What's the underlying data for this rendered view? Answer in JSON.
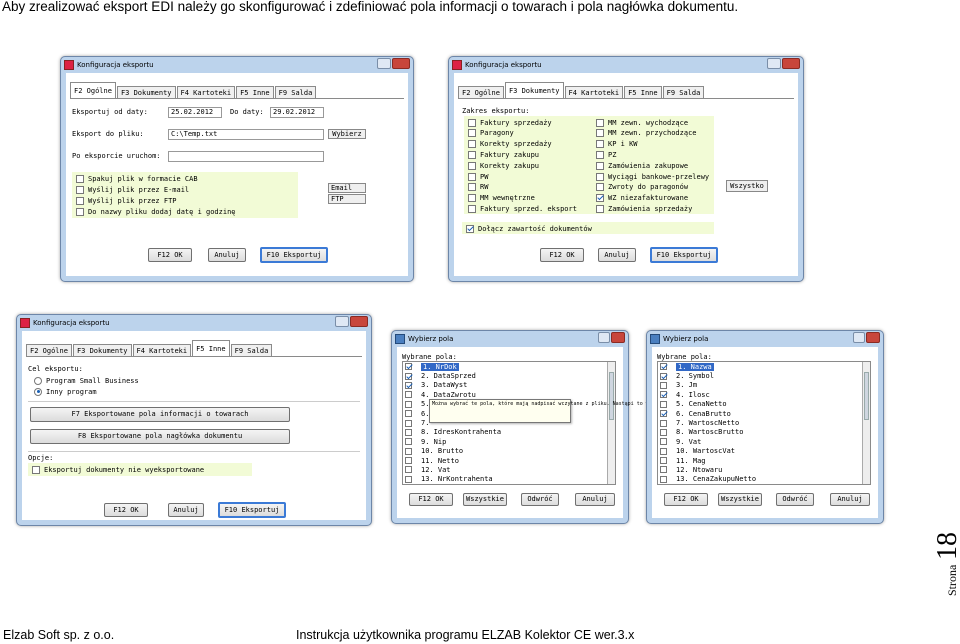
{
  "heading": "Aby zrealizować eksport EDI należy go skonfigurować i zdefiniować pola informacji o towarach i pola nagłówka dokumentu.",
  "footer": {
    "left": "Elzab Soft sp. z o.o.",
    "center": "Instrukcja użytkownika programu ELZAB Kolektor CE wer.3.x",
    "page_word": "Strona",
    "page_num": "18"
  },
  "tabs": [
    "F2 Ogólne",
    "F3 Dokumenty",
    "F4 Kartoteki",
    "F5 Inne",
    "F9 Salda"
  ],
  "buttons": {
    "ok": "F12 OK",
    "cancel": "Anuluj",
    "export": "F10 Eksportuj"
  },
  "w1": {
    "title": "Konfiguracja eksportu",
    "export_from_label": "Eksportuj od daty:",
    "date_from": "25.02.2012",
    "to_label": "Do daty:",
    "date_to": "29.02.2012",
    "file_label": "Eksport do pliku:",
    "file_value": "C:\\Temp.txt",
    "choose": "Wybierz",
    "after_label": "Po eksporcie uruchom:",
    "after_value": "",
    "opts": [
      {
        "label": "Spakuj plik w formacie CAB",
        "checked": false
      },
      {
        "label": "Wyślij plik przez E-mail",
        "checked": false
      },
      {
        "label": "Wyślij plik przez FTP",
        "checked": false
      },
      {
        "label": "Do nazwy pliku dodaj datę i godzinę",
        "checked": false
      }
    ],
    "email": "Email",
    "ftp": "FTP"
  },
  "w2": {
    "title": "Konfiguracja eksportu",
    "scope_label": "Zakres eksportu:",
    "col1": [
      {
        "label": "Faktury sprzedaży",
        "checked": false
      },
      {
        "label": "Paragony",
        "checked": false
      },
      {
        "label": "Korekty sprzedaży",
        "checked": false
      },
      {
        "label": "Faktury zakupu",
        "checked": false
      },
      {
        "label": "Korekty zakupu",
        "checked": false
      },
      {
        "label": "PW",
        "checked": false
      },
      {
        "label": "RW",
        "checked": false
      },
      {
        "label": "MM wewnętrzne",
        "checked": false
      },
      {
        "label": "Faktury sprzed. eksport",
        "checked": false
      }
    ],
    "col2": [
      {
        "label": "MM zewn. wychodzące",
        "checked": false
      },
      {
        "label": "MM zewn. przychodzące",
        "checked": false
      },
      {
        "label": "KP i KW",
        "checked": false
      },
      {
        "label": "PZ",
        "checked": false
      },
      {
        "label": "Zamówienia zakupowe",
        "checked": false
      },
      {
        "label": "Wyciągi bankowe-przelewy",
        "checked": false
      },
      {
        "label": "Zwroty do paragonów",
        "checked": false
      },
      {
        "label": "WZ niezafakturowane",
        "checked": true
      },
      {
        "label": "Zamówienia sprzedaży",
        "checked": false
      }
    ],
    "all": "Wszystko",
    "attach": {
      "label": "Dołącz zawartość dokumentów",
      "checked": true
    }
  },
  "w3": {
    "title": "Konfiguracja eksportu",
    "target_label": "Cel eksportu:",
    "radios": [
      {
        "label": "Program Small Business",
        "checked": false
      },
      {
        "label": "Inny program",
        "checked": true
      }
    ],
    "f7": "F7 Eksportowane pola informacji o towarach",
    "f8": "F8 Eksportowane pola nagłówka dokumentu",
    "opts_label": "Opcje:",
    "opt": {
      "label": "Eksportuj dokumenty nie wyeksportowane",
      "checked": false
    }
  },
  "w4": {
    "title": "Wybierz pola",
    "list_label": "Wybrane pola:",
    "items": [
      {
        "label": "1. NrDok",
        "checked": true
      },
      {
        "label": "2. DataSprzed",
        "checked": true
      },
      {
        "label": "3. DataWyst",
        "checked": true
      },
      {
        "label": "4. DataZwrotu",
        "checked": false
      },
      {
        "label": "5. ",
        "checked": false
      },
      {
        "label": "6. ",
        "checked": false
      },
      {
        "label": "7. ",
        "checked": false
      },
      {
        "label": "8. IdresKontrahenta",
        "checked": false
      },
      {
        "label": "9. Nip",
        "checked": false
      },
      {
        "label": "10. Brutto",
        "checked": false
      },
      {
        "label": "11. Netto",
        "checked": false
      },
      {
        "label": "12. Vat",
        "checked": false
      },
      {
        "label": "13. NrKontrahenta",
        "checked": false
      }
    ],
    "tooltip": "Można wybrać te pola, które mają nadpisać wczytane z pliku. Nastąpi to w chwili poprawnej identyfikacji towaru we wskazanych magazynach.",
    "btns": {
      "ok": "F12 OK",
      "all": "Wszystkie",
      "inv": "Odwróć",
      "cancel": "Anuluj"
    }
  },
  "w5": {
    "title": "Wybierz pola",
    "list_label": "Wybrane pola:",
    "items": [
      {
        "label": "1. Nazwa",
        "checked": true
      },
      {
        "label": "2. Symbol",
        "checked": true
      },
      {
        "label": "3. Jm",
        "checked": false
      },
      {
        "label": "4. Ilosc",
        "checked": true
      },
      {
        "label": "5. CenaNetto",
        "checked": false
      },
      {
        "label": "6. CenaBrutto",
        "checked": true
      },
      {
        "label": "7. WartoscNetto",
        "checked": false
      },
      {
        "label": "8. WartoscBrutto",
        "checked": false
      },
      {
        "label": "9. Vat",
        "checked": false
      },
      {
        "label": "10. WartoscVat",
        "checked": false
      },
      {
        "label": "11. Mag",
        "checked": false
      },
      {
        "label": "12. Ntowaru",
        "checked": false
      },
      {
        "label": "13. CenaZakupuNetto",
        "checked": false
      }
    ],
    "btns": {
      "ok": "F12 OK",
      "all": "Wszystkie",
      "inv": "Odwróć",
      "cancel": "Anuluj"
    }
  }
}
